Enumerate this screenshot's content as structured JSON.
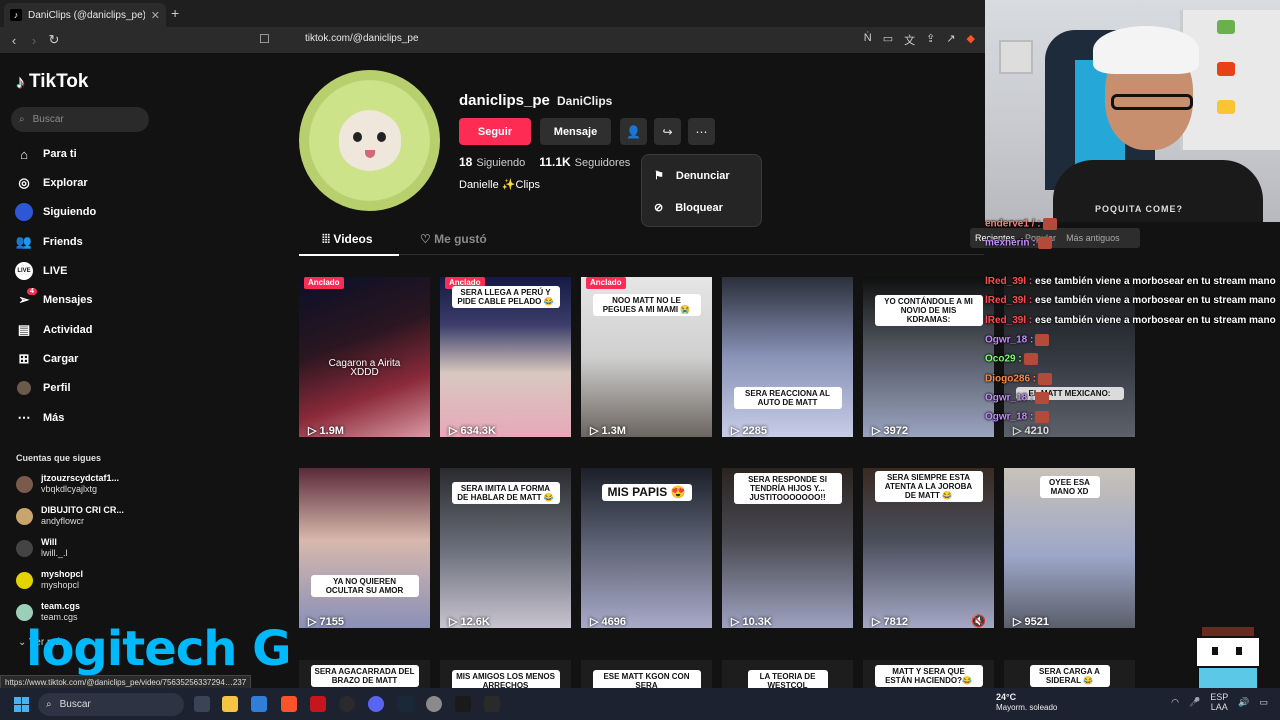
{
  "browser": {
    "tab_title": "DaniClips (@daniclips_pe) | TikTo",
    "url": "tiktok.com/@daniclips_pe",
    "status_url": "https://www.tiktok.com/@daniclips_pe/video/75635256337294…237"
  },
  "sidebar": {
    "brand": "TikTok",
    "search_placeholder": "Buscar",
    "items": [
      {
        "label": "Para ti",
        "icon": "home-icon"
      },
      {
        "label": "Explorar",
        "icon": "compass-icon"
      },
      {
        "label": "Siguiendo",
        "icon": "following-avatar-icon"
      },
      {
        "label": "Friends",
        "icon": "friends-icon"
      },
      {
        "label": "LIVE",
        "icon": "live-icon"
      },
      {
        "label": "Mensajes",
        "icon": "send-icon",
        "badge": "4"
      },
      {
        "label": "Actividad",
        "icon": "activity-icon"
      },
      {
        "label": "Cargar",
        "icon": "upload-icon"
      },
      {
        "label": "Perfil",
        "icon": "profile-icon"
      },
      {
        "label": "Más",
        "icon": "more-icon"
      }
    ],
    "following_title": "Cuentas que sigues",
    "accounts": [
      {
        "name": "jtzouzrscydctaf1...",
        "user": "vbqkdlcyajlxtg"
      },
      {
        "name": "DIBUJITO CRI CR...",
        "user": "andyflowcr"
      },
      {
        "name": "Will",
        "user": "lwill._.l"
      },
      {
        "name": "myshopcl",
        "user": "myshopcl"
      },
      {
        "name": "team.cgs",
        "user": "team.cgs"
      }
    ],
    "see_more": "Ver más"
  },
  "profile": {
    "username": "daniclips_pe",
    "nickname": "DaniClips",
    "follow_label": "Seguir",
    "message_label": "Mensaje",
    "following_count": "18",
    "following_label": "Siguiendo",
    "followers_count": "11.1K",
    "followers_label": "Seguidores",
    "bio": "Danielle ✨Clips"
  },
  "dropdown": {
    "report": "Denunciar",
    "block": "Bloquear"
  },
  "tabs": {
    "videos": "Videos",
    "liked": "Me gustó"
  },
  "videos": [
    {
      "views": "1.9M",
      "pinned": "Anclado",
      "caption": "Cagaron a Airita XDDD",
      "plain": true
    },
    {
      "views": "634.3K",
      "pinned": "Anclado",
      "caption": "SERA LLEGA A PERÚ Y PIDE CABLE PELADO 😂"
    },
    {
      "views": "1.3M",
      "pinned": "Anclado",
      "caption": "NOO MATT NO LE PEGUES A MI MAMI 😭"
    },
    {
      "views": "2285",
      "caption": "SERA REACCIONA AL AUTO DE MATT"
    },
    {
      "views": "3972",
      "caption": "YO CONTÁNDOLE A MI NOVIO DE MIS KDRAMAS:"
    },
    {
      "views": "4210",
      "caption": "EL MATT MEXICANO:"
    },
    {
      "views": "7155",
      "caption": "YA NO QUIEREN OCULTAR SU AMOR"
    },
    {
      "views": "12.6K",
      "caption": "SERA IMITA LA FORMA DE HABLAR DE MATT 😂"
    },
    {
      "views": "4696",
      "caption": "MIS PAPIS 😍"
    },
    {
      "views": "10.3K",
      "caption": "SERA RESPONDE SI TENDRÍA HIJOS Y... JUSTITOOOOOOO!!"
    },
    {
      "views": "7812",
      "caption": "SERA SIEMPRE ESTA ATENTA A LA JOROBA DE MATT 😂"
    },
    {
      "views": "9521",
      "caption": "OYEE ESA MANO XD"
    },
    {
      "caption": "SERA AGACARRADA DEL BRAZO DE MATT"
    },
    {
      "caption": "MIS AMIGOS LOS MENOS ARRECHOS"
    },
    {
      "caption": "ESE MATT KGON CON SERA"
    },
    {
      "caption": "LA TEORIA DE WESTCOL"
    },
    {
      "caption": "MATT Y SERA QUE ESTÁN HACIENDO?😂"
    },
    {
      "caption": "SERA CARGA A SIDERAL 😂"
    }
  ],
  "stream_chat": {
    "sort": [
      "Recientes",
      "Popular",
      "Más antiguos"
    ],
    "lines": [
      {
        "user": "enderve1 / :",
        "text": "",
        "color": "#ff7a7a"
      },
      {
        "user": "mexnerin :",
        "text": "",
        "color": "#c38cff"
      },
      {
        "user": "lRed_39l :",
        "text": "ese también viene a morbosear en tu stream mano",
        "color": "#ff4d4d"
      },
      {
        "user": "lRed_39l :",
        "text": "ese también viene a morbosear en tu stream mano",
        "color": "#ff4d4d"
      },
      {
        "user": "lRed_39l :",
        "text": "ese también viene a morbosear en tu stream mano",
        "color": "#ff4d4d"
      },
      {
        "user": "Ogwr_18 :",
        "text": "",
        "color": "#c38cff"
      },
      {
        "user": "Oco29 :",
        "text": "",
        "color": "#7cff6a"
      },
      {
        "user": "Diogo286 :",
        "text": "",
        "color": "#ff8a3d"
      },
      {
        "user": "Ogwr_18 :",
        "text": "",
        "color": "#c38cff"
      },
      {
        "user": "Ogwr_18 :",
        "text": "",
        "color": "#c38cff"
      },
      {
        "user": "Ogwr_18 :",
        "text": "",
        "color": "#c38cff"
      }
    ],
    "webcam_shirt": "POQUITA COME?"
  },
  "overlay": {
    "sponsor": "logitech G"
  },
  "taskbar": {
    "search": "Buscar",
    "temp": "24°C",
    "weather": "Mayorm. soleado",
    "lang": "ESP",
    "lang2": "LAA"
  },
  "colors": {
    "accent": "#fe2c55",
    "background": "#121212",
    "logitech": "#00b8fc"
  }
}
